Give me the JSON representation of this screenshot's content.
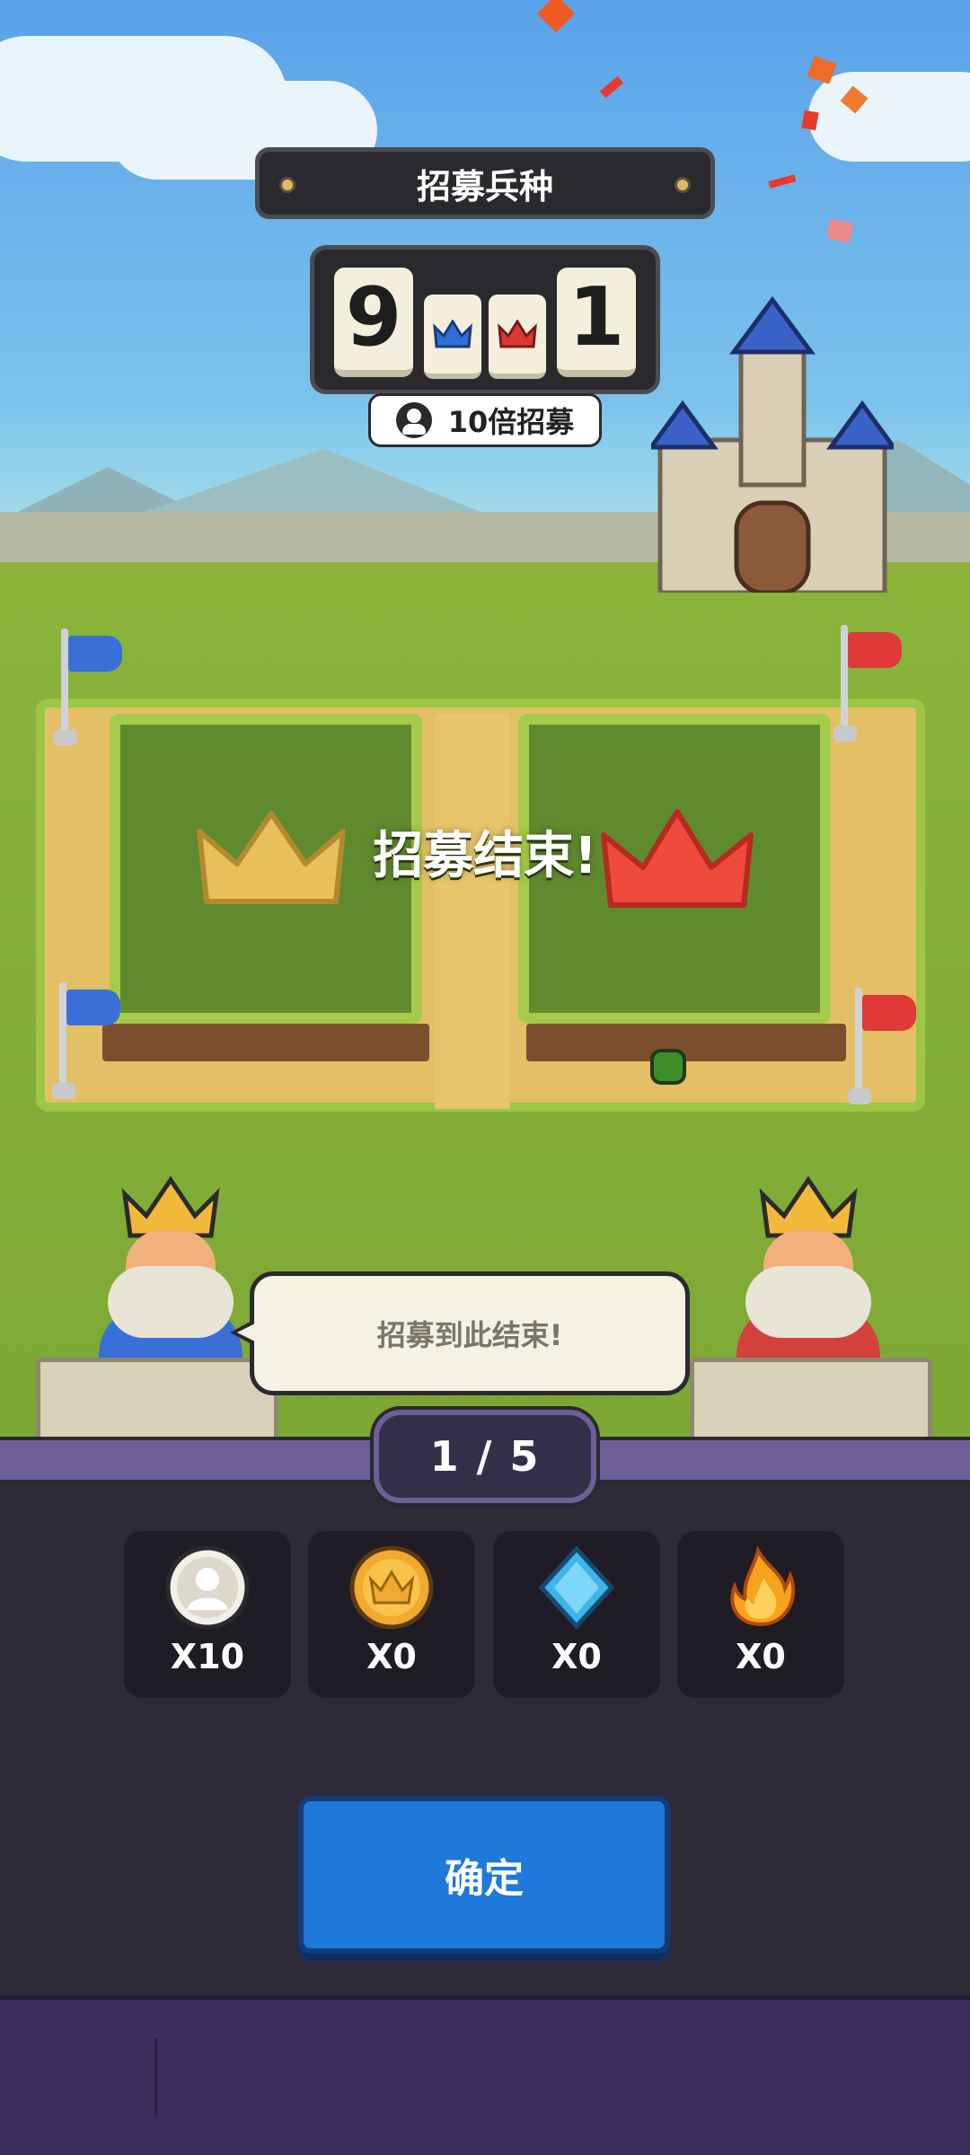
{
  "header": {
    "title": "招募兵种"
  },
  "counter": {
    "left_digit": "9",
    "right_digit": "1"
  },
  "multiplier": {
    "label": "10倍招募",
    "icon": "person-icon"
  },
  "field": {
    "result_text": "招募结束!",
    "left_crown_color": "#e8c05a",
    "right_crown_color": "#ef4b3c"
  },
  "dialog": {
    "text": "招募到此结束!"
  },
  "pagination": {
    "label": "1 / 5"
  },
  "rewards": [
    {
      "icon": "person-token-icon",
      "count": "X10"
    },
    {
      "icon": "gold-crown-coin-icon",
      "count": "X0"
    },
    {
      "icon": "blue-gem-icon",
      "count": "X0"
    },
    {
      "icon": "fire-icon",
      "count": "X0"
    }
  ],
  "actions": {
    "confirm_label": "确定"
  },
  "colors": {
    "team_blue": "#3a6fd8",
    "team_red": "#e0393a",
    "confirm": "#1f79d9",
    "panel": "#2e2a38",
    "band": "#6c5f9a"
  }
}
